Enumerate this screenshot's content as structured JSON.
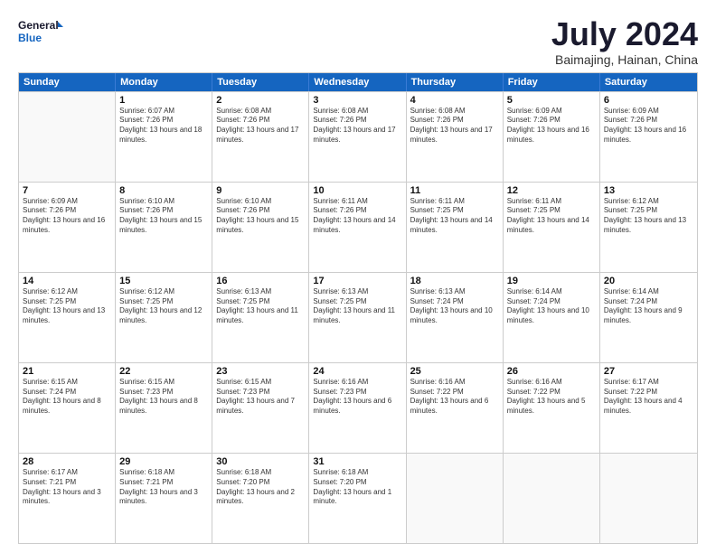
{
  "header": {
    "logo_line1": "General",
    "logo_line2": "Blue",
    "month": "July 2024",
    "location": "Baimajing, Hainan, China"
  },
  "days": [
    "Sunday",
    "Monday",
    "Tuesday",
    "Wednesday",
    "Thursday",
    "Friday",
    "Saturday"
  ],
  "weeks": [
    [
      {
        "day": "",
        "sunrise": "",
        "sunset": "",
        "daylight": ""
      },
      {
        "day": "1",
        "sunrise": "Sunrise: 6:07 AM",
        "sunset": "Sunset: 7:26 PM",
        "daylight": "Daylight: 13 hours and 18 minutes."
      },
      {
        "day": "2",
        "sunrise": "Sunrise: 6:08 AM",
        "sunset": "Sunset: 7:26 PM",
        "daylight": "Daylight: 13 hours and 17 minutes."
      },
      {
        "day": "3",
        "sunrise": "Sunrise: 6:08 AM",
        "sunset": "Sunset: 7:26 PM",
        "daylight": "Daylight: 13 hours and 17 minutes."
      },
      {
        "day": "4",
        "sunrise": "Sunrise: 6:08 AM",
        "sunset": "Sunset: 7:26 PM",
        "daylight": "Daylight: 13 hours and 17 minutes."
      },
      {
        "day": "5",
        "sunrise": "Sunrise: 6:09 AM",
        "sunset": "Sunset: 7:26 PM",
        "daylight": "Daylight: 13 hours and 16 minutes."
      },
      {
        "day": "6",
        "sunrise": "Sunrise: 6:09 AM",
        "sunset": "Sunset: 7:26 PM",
        "daylight": "Daylight: 13 hours and 16 minutes."
      }
    ],
    [
      {
        "day": "7",
        "sunrise": "Sunrise: 6:09 AM",
        "sunset": "Sunset: 7:26 PM",
        "daylight": "Daylight: 13 hours and 16 minutes."
      },
      {
        "day": "8",
        "sunrise": "Sunrise: 6:10 AM",
        "sunset": "Sunset: 7:26 PM",
        "daylight": "Daylight: 13 hours and 15 minutes."
      },
      {
        "day": "9",
        "sunrise": "Sunrise: 6:10 AM",
        "sunset": "Sunset: 7:26 PM",
        "daylight": "Daylight: 13 hours and 15 minutes."
      },
      {
        "day": "10",
        "sunrise": "Sunrise: 6:11 AM",
        "sunset": "Sunset: 7:26 PM",
        "daylight": "Daylight: 13 hours and 14 minutes."
      },
      {
        "day": "11",
        "sunrise": "Sunrise: 6:11 AM",
        "sunset": "Sunset: 7:25 PM",
        "daylight": "Daylight: 13 hours and 14 minutes."
      },
      {
        "day": "12",
        "sunrise": "Sunrise: 6:11 AM",
        "sunset": "Sunset: 7:25 PM",
        "daylight": "Daylight: 13 hours and 14 minutes."
      },
      {
        "day": "13",
        "sunrise": "Sunrise: 6:12 AM",
        "sunset": "Sunset: 7:25 PM",
        "daylight": "Daylight: 13 hours and 13 minutes."
      }
    ],
    [
      {
        "day": "14",
        "sunrise": "Sunrise: 6:12 AM",
        "sunset": "Sunset: 7:25 PM",
        "daylight": "Daylight: 13 hours and 13 minutes."
      },
      {
        "day": "15",
        "sunrise": "Sunrise: 6:12 AM",
        "sunset": "Sunset: 7:25 PM",
        "daylight": "Daylight: 13 hours and 12 minutes."
      },
      {
        "day": "16",
        "sunrise": "Sunrise: 6:13 AM",
        "sunset": "Sunset: 7:25 PM",
        "daylight": "Daylight: 13 hours and 11 minutes."
      },
      {
        "day": "17",
        "sunrise": "Sunrise: 6:13 AM",
        "sunset": "Sunset: 7:25 PM",
        "daylight": "Daylight: 13 hours and 11 minutes."
      },
      {
        "day": "18",
        "sunrise": "Sunrise: 6:13 AM",
        "sunset": "Sunset: 7:24 PM",
        "daylight": "Daylight: 13 hours and 10 minutes."
      },
      {
        "day": "19",
        "sunrise": "Sunrise: 6:14 AM",
        "sunset": "Sunset: 7:24 PM",
        "daylight": "Daylight: 13 hours and 10 minutes."
      },
      {
        "day": "20",
        "sunrise": "Sunrise: 6:14 AM",
        "sunset": "Sunset: 7:24 PM",
        "daylight": "Daylight: 13 hours and 9 minutes."
      }
    ],
    [
      {
        "day": "21",
        "sunrise": "Sunrise: 6:15 AM",
        "sunset": "Sunset: 7:24 PM",
        "daylight": "Daylight: 13 hours and 8 minutes."
      },
      {
        "day": "22",
        "sunrise": "Sunrise: 6:15 AM",
        "sunset": "Sunset: 7:23 PM",
        "daylight": "Daylight: 13 hours and 8 minutes."
      },
      {
        "day": "23",
        "sunrise": "Sunrise: 6:15 AM",
        "sunset": "Sunset: 7:23 PM",
        "daylight": "Daylight: 13 hours and 7 minutes."
      },
      {
        "day": "24",
        "sunrise": "Sunrise: 6:16 AM",
        "sunset": "Sunset: 7:23 PM",
        "daylight": "Daylight: 13 hours and 6 minutes."
      },
      {
        "day": "25",
        "sunrise": "Sunrise: 6:16 AM",
        "sunset": "Sunset: 7:22 PM",
        "daylight": "Daylight: 13 hours and 6 minutes."
      },
      {
        "day": "26",
        "sunrise": "Sunrise: 6:16 AM",
        "sunset": "Sunset: 7:22 PM",
        "daylight": "Daylight: 13 hours and 5 minutes."
      },
      {
        "day": "27",
        "sunrise": "Sunrise: 6:17 AM",
        "sunset": "Sunset: 7:22 PM",
        "daylight": "Daylight: 13 hours and 4 minutes."
      }
    ],
    [
      {
        "day": "28",
        "sunrise": "Sunrise: 6:17 AM",
        "sunset": "Sunset: 7:21 PM",
        "daylight": "Daylight: 13 hours and 3 minutes."
      },
      {
        "day": "29",
        "sunrise": "Sunrise: 6:18 AM",
        "sunset": "Sunset: 7:21 PM",
        "daylight": "Daylight: 13 hours and 3 minutes."
      },
      {
        "day": "30",
        "sunrise": "Sunrise: 6:18 AM",
        "sunset": "Sunset: 7:20 PM",
        "daylight": "Daylight: 13 hours and 2 minutes."
      },
      {
        "day": "31",
        "sunrise": "Sunrise: 6:18 AM",
        "sunset": "Sunset: 7:20 PM",
        "daylight": "Daylight: 13 hours and 1 minute."
      },
      {
        "day": "",
        "sunrise": "",
        "sunset": "",
        "daylight": ""
      },
      {
        "day": "",
        "sunrise": "",
        "sunset": "",
        "daylight": ""
      },
      {
        "day": "",
        "sunrise": "",
        "sunset": "",
        "daylight": ""
      }
    ]
  ]
}
